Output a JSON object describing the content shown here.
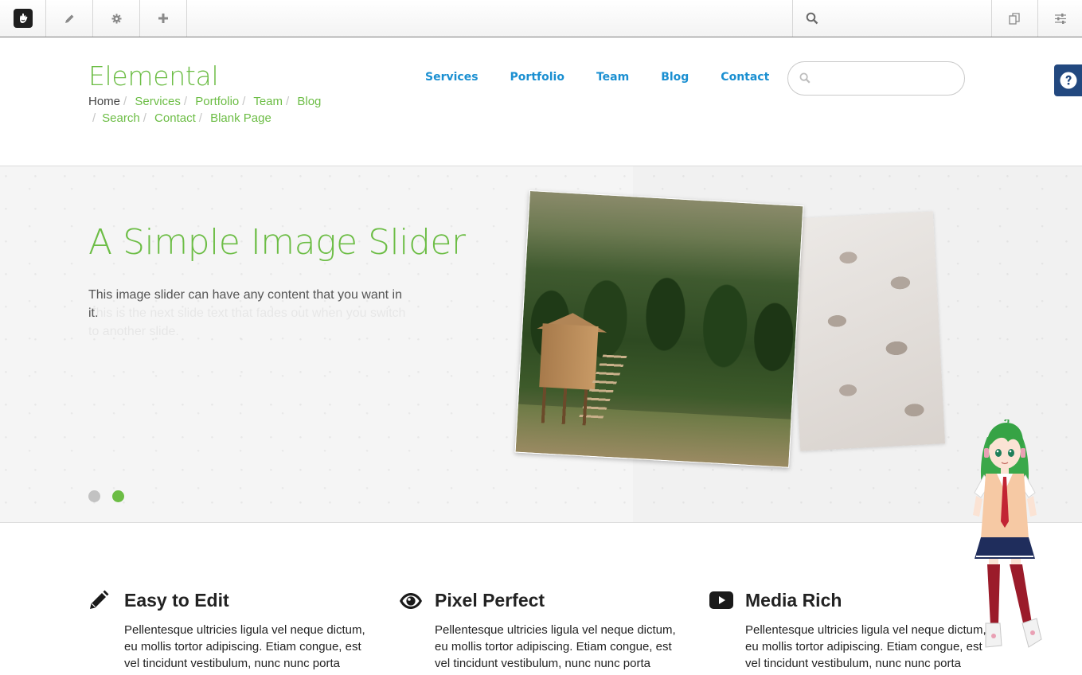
{
  "cms_toolbar": {
    "buttons": [
      "concrete5-logo-icon",
      "pencil-icon",
      "gear-icon",
      "plus-icon"
    ],
    "search_icon": "search-icon",
    "right_buttons": [
      "pages-icon",
      "sliders-icon"
    ]
  },
  "site": {
    "title": "Elemental",
    "breadcrumb": {
      "home": "Home",
      "links": [
        "Services",
        "Portfolio",
        "Team",
        "Blog",
        "Search",
        "Contact",
        "Blank Page"
      ]
    },
    "nav": [
      "Services",
      "Portfolio",
      "Team",
      "Blog",
      "Contact"
    ],
    "search": {
      "placeholder": "",
      "value": ""
    },
    "help_icon": "help-icon"
  },
  "hero": {
    "title": "A Simple Image Slider",
    "text": "This image slider can have any content that you want in it.",
    "ghost_text": "This is the next slide text that fades out when you switch to another slide.",
    "dots": {
      "count": 2,
      "active_index": 1
    }
  },
  "features": [
    {
      "icon": "pencil-icon",
      "title": "Easy to Edit",
      "text": "Pellentesque ultricies ligula vel neque dictum, eu mollis tortor adipiscing. Etiam congue, est vel tincidunt vestibulum, nunc nunc porta"
    },
    {
      "icon": "eye-icon",
      "title": "Pixel Perfect",
      "text": "Pellentesque ultricies ligula vel neque dictum, eu mollis tortor adipiscing. Etiam congue, est vel tincidunt vestibulum, nunc nunc porta"
    },
    {
      "icon": "play-icon",
      "title": "Media Rich",
      "text": "Pellentesque ultricies ligula vel neque dictum, eu mollis tortor adipiscing. Etiam congue, est vel tincidunt vestibulum, nunc nunc porta"
    }
  ],
  "colors": {
    "brand_green": "#6cbd45",
    "nav_blue": "#1a8fd1",
    "help_navy": "#22487f",
    "dot_inactive": "#c2c2c2"
  }
}
